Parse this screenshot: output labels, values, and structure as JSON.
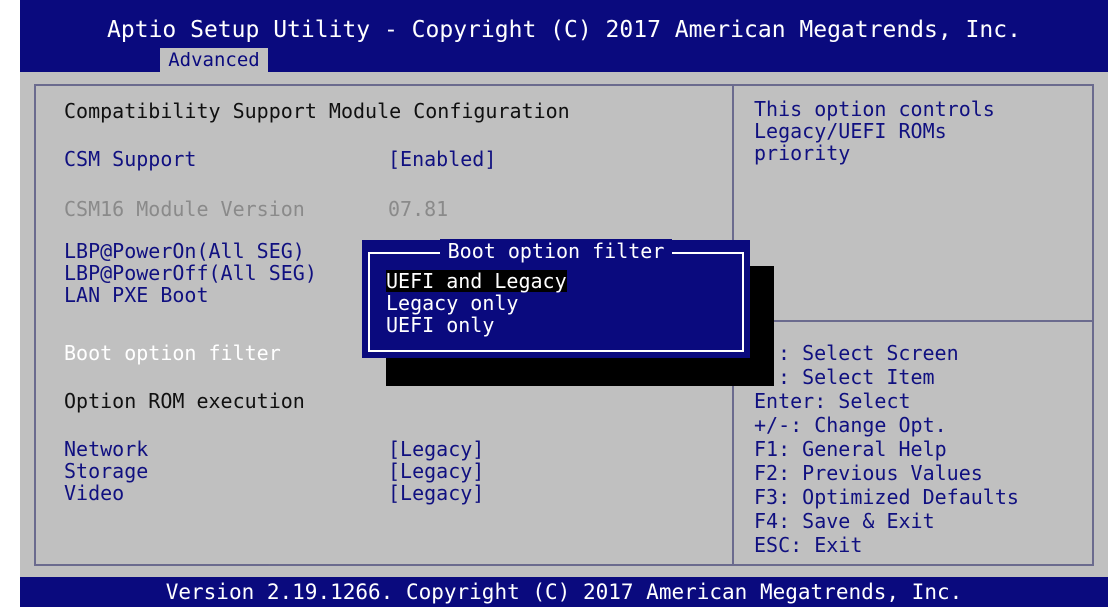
{
  "header": {
    "title": "Aptio Setup Utility - Copyright (C) 2017 American Megatrends, Inc.",
    "tab": "Advanced"
  },
  "main": {
    "heading": "Compatibility Support Module Configuration",
    "csm_support": {
      "label": "CSM Support",
      "value": "[Enabled]"
    },
    "csm16_version": {
      "label": "CSM16 Module Version",
      "value": "07.81"
    },
    "lbp_power_on": {
      "label": "LBP@PowerOn(All SEG)"
    },
    "lbp_power_off": {
      "label": "LBP@PowerOff(All SEG)"
    },
    "lan_pxe_boot": {
      "label": "LAN PXE Boot"
    },
    "boot_option_filter": {
      "label": "Boot option filter"
    },
    "option_rom_heading": "Option ROM execution",
    "network": {
      "label": "Network",
      "value": "[Legacy]"
    },
    "storage": {
      "label": "Storage",
      "value": "[Legacy]"
    },
    "video": {
      "label": "Video",
      "value": "[Legacy]"
    }
  },
  "popup": {
    "title": "Boot option filter",
    "options": [
      "UEFI and Legacy",
      "Legacy only",
      "UEFI only"
    ],
    "selected": "UEFI and Legacy"
  },
  "help": {
    "description": [
      "This option controls",
      "Legacy/UEFI ROMs",
      "priority"
    ],
    "keys": [
      ": Select Screen",
      ": Select Item",
      "Enter: Select",
      "+/-: Change Opt.",
      "F1: General Help",
      "F2: Previous Values",
      "F3: Optimized Defaults",
      "F4: Save & Exit",
      "ESC: Exit"
    ]
  },
  "footer": {
    "text": "Version 2.19.1266. Copyright (C) 2017 American Megatrends, Inc."
  },
  "colors": {
    "bios_blue": "#0a0a7e",
    "panel_gray": "#c0c0c0",
    "highlight_white": "#ffffff"
  }
}
